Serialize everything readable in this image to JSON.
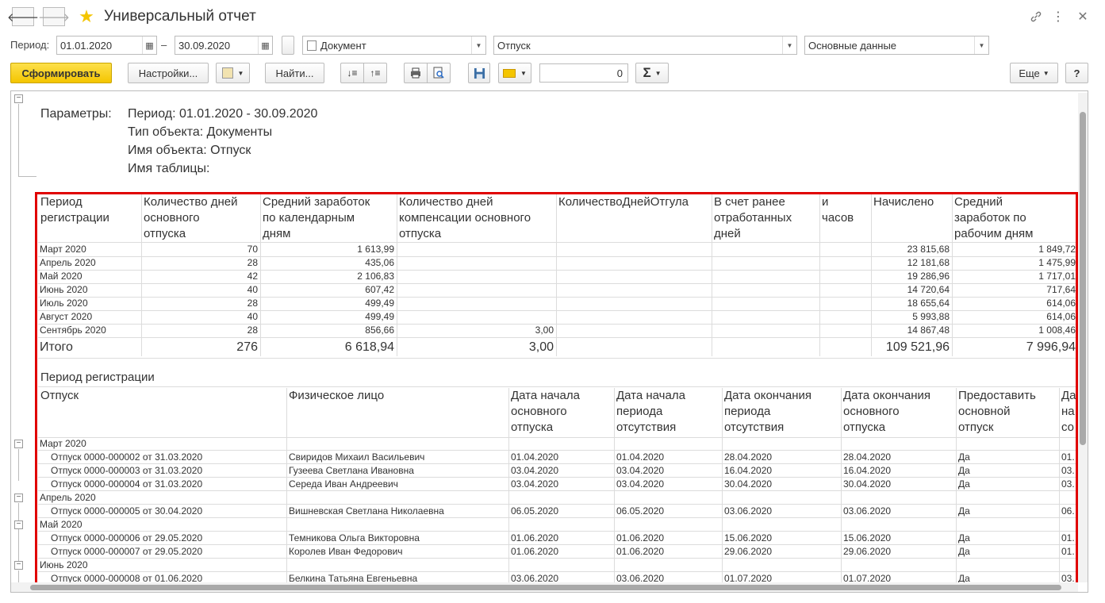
{
  "window": {
    "title": "Универсальный отчет",
    "back_icon": "arrow-left-icon",
    "forward_icon": "arrow-right-icon",
    "favorite_icon": "star-icon",
    "link_icon": "link-icon",
    "more_icon": "vertical-dots-icon",
    "close_icon": "close-icon"
  },
  "filters": {
    "period_label": "Период:",
    "date_from": "01.01.2020",
    "dash": "–",
    "date_to": "30.09.2020",
    "object_type": "Документ",
    "object_name": "Отпуск",
    "table_name": "Основные данные"
  },
  "toolbar": {
    "generate": "Сформировать",
    "settings": "Настройки...",
    "find": "Найти...",
    "number_value": "0",
    "sum_symbol": "Σ",
    "more": "Еще",
    "help": "?"
  },
  "report": {
    "params_label": "Параметры:",
    "params": [
      "Период: 01.01.2020 - 30.09.2020",
      "Тип объекта: Документы",
      "Имя объекта: Отпуск",
      "Имя таблицы:"
    ],
    "table1": {
      "headers": [
        "Период\nрегистрации",
        "Количество дней\nосновного\nотпуска",
        "Средний заработок\nпо календарным\nдням",
        "Количество дней\nкомпенсации основного\nотпуска",
        "КоличествоДнейОтгула",
        "В счет ранее\nотработанных\nдней",
        "и\nчасов",
        "Начислено",
        "Средний\nзаработок по\nрабочим дням"
      ],
      "rows": [
        [
          "Март 2020",
          "70",
          "1 613,99",
          "",
          "",
          "",
          "",
          "23 815,68",
          "1 849,72"
        ],
        [
          "Апрель 2020",
          "28",
          "435,06",
          "",
          "",
          "",
          "",
          "12 181,68",
          "1 475,99"
        ],
        [
          "Май 2020",
          "42",
          "2 106,83",
          "",
          "",
          "",
          "",
          "19 286,96",
          "1 717,01"
        ],
        [
          "Июнь 2020",
          "40",
          "607,42",
          "",
          "",
          "",
          "",
          "14 720,64",
          "717,64"
        ],
        [
          "Июль 2020",
          "28",
          "499,49",
          "",
          "",
          "",
          "",
          "18 655,64",
          "614,06"
        ],
        [
          "Август 2020",
          "40",
          "499,49",
          "",
          "",
          "",
          "",
          "5 993,88",
          "614,06"
        ],
        [
          "Сентябрь 2020",
          "28",
          "856,66",
          "3,00",
          "",
          "",
          "",
          "14 867,48",
          "1 008,46"
        ]
      ],
      "total": [
        "Итого",
        "276",
        "6 618,94",
        "3,00",
        "",
        "",
        "",
        "109 521,96",
        "7 996,94"
      ]
    },
    "table2": {
      "group_header": "Период регистрации",
      "headers": [
        "Отпуск",
        "Физическое лицо",
        "Дата начала\nосновного\nотпуска",
        "Дата начала\nпериода\nотсутствия",
        "Дата окончания\nпериода\nотсутствия",
        "Дата окончания\nосновного\nотпуска",
        "Предоставить\nосновной\nотпуск",
        "Да\nна\nсо"
      ],
      "rows": [
        {
          "type": "group",
          "text": "Март 2020"
        },
        {
          "type": "row",
          "cells": [
            "Отпуск 0000-000002 от 31.03.2020",
            "Свиридов Михаил Васильевич",
            "01.04.2020",
            "01.04.2020",
            "28.04.2020",
            "28.04.2020",
            "Да",
            "01."
          ]
        },
        {
          "type": "row",
          "cells": [
            "Отпуск 0000-000003 от 31.03.2020",
            "Гузеева Светлана Ивановна",
            "03.04.2020",
            "03.04.2020",
            "16.04.2020",
            "16.04.2020",
            "Да",
            "03."
          ]
        },
        {
          "type": "row",
          "cells": [
            "Отпуск 0000-000004 от 31.03.2020",
            "Середа Иван Андреевич",
            "03.04.2020",
            "03.04.2020",
            "30.04.2020",
            "30.04.2020",
            "Да",
            "03."
          ]
        },
        {
          "type": "group",
          "text": "Апрель 2020"
        },
        {
          "type": "row",
          "cells": [
            "Отпуск 0000-000005 от 30.04.2020",
            "Вишневская Светлана Николаевна",
            "06.05.2020",
            "06.05.2020",
            "03.06.2020",
            "03.06.2020",
            "Да",
            "06."
          ]
        },
        {
          "type": "group",
          "text": "Май 2020"
        },
        {
          "type": "row",
          "cells": [
            "Отпуск 0000-000006 от 29.05.2020",
            "Темникова Ольга Викторовна",
            "01.06.2020",
            "01.06.2020",
            "15.06.2020",
            "15.06.2020",
            "Да",
            "01."
          ]
        },
        {
          "type": "row",
          "cells": [
            "Отпуск 0000-000007 от 29.05.2020",
            "Королев Иван Федорович",
            "01.06.2020",
            "01.06.2020",
            "29.06.2020",
            "29.06.2020",
            "Да",
            "01."
          ]
        },
        {
          "type": "group",
          "text": "Июнь 2020"
        },
        {
          "type": "row",
          "cells": [
            "Отпуск 0000-000008 от 01.06.2020",
            "Белкина Татьяна Евгеньевна",
            "03.06.2020",
            "03.06.2020",
            "01.07.2020",
            "01.07.2020",
            "Да",
            "03."
          ]
        }
      ]
    }
  },
  "colors": {
    "highlight": "#e00000",
    "accent": "#f4c500"
  }
}
